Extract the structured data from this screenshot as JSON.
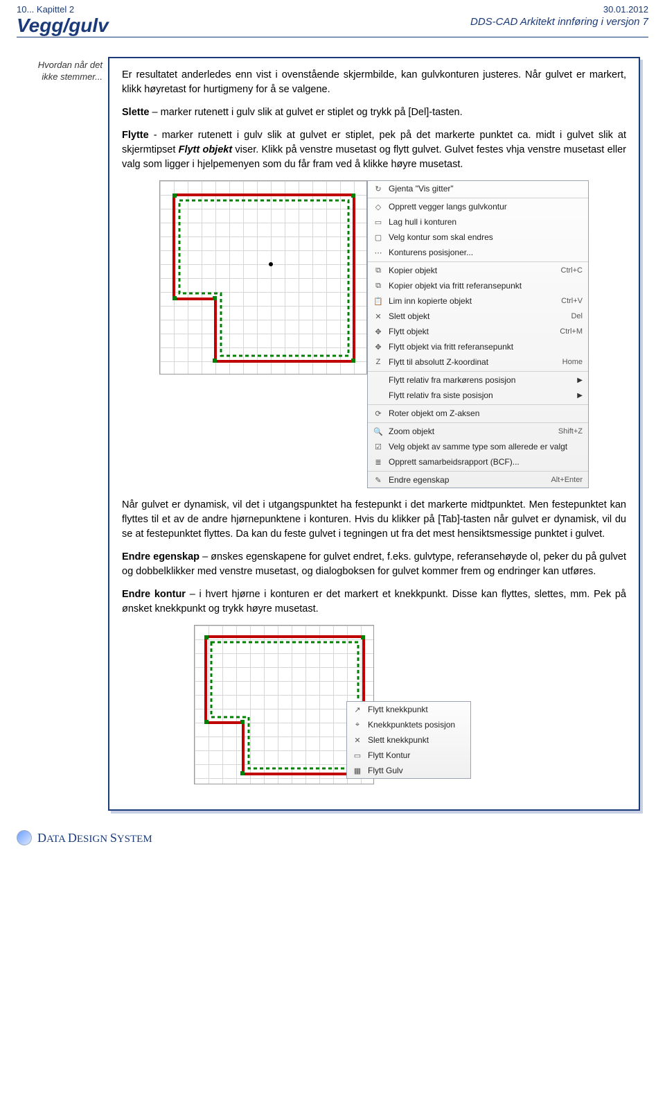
{
  "header": {
    "chapter_ref": "10... Kapittel 2",
    "section_title": "Vegg/gulv",
    "date": "30.01.2012",
    "product_name": "DDS-CAD Arkitekt innføring i versjon 7"
  },
  "margin_note": "Hvordan når det ikke stemmer...",
  "body": {
    "p1": "Er resultatet anderledes enn vist i ovenstående skjermbilde, kan gulvkonturen justeres. Når gulvet er markert, klikk høyretast for hurtigmeny for å se valgene.",
    "p2_prefix": "Slette",
    "p2_rest": " – marker rutenett i gulv slik at gulvet er stiplet og trykk på [Del]-tasten.",
    "p3_prefix": "Flytte",
    "p3_rest": " - marker rutenett i gulv slik at gulvet er stiplet, pek på det markerte punktet ca. midt i gulvet slik at skjermtipset ",
    "p3_em": "Flytt objekt",
    "p3_rest2": " viser. Klikk på venstre musetast og flytt gulvet. Gulvet festes vhja venstre musetast eller valg som ligger i hjelpemenyen som du får fram ved å klikke høyre musetast.",
    "p4": "Når gulvet er dynamisk, vil det i utgangspunktet ha festepunkt i det markerte midtpunktet. Men festepunktet kan flyttes til et av de andre hjørnepunktene i konturen. Hvis du klikker på [Tab]-tasten når gulvet er dynamisk, vil du se at festepunktet flyttes. Da kan du feste gulvet i tegningen ut fra det mest hensiktsmessige punktet i gulvet.",
    "p5_prefix": "Endre egenskap",
    "p5_rest": " – ønskes egenskapene for gulvet endret, f.eks. gulvtype, referansehøyde ol, peker du på gulvet og dobbelklikker med venstre musetast, og dialogboksen for gulvet kommer frem og endringer kan utføres.",
    "p6_prefix": "Endre kontur",
    "p6_rest": " – i hvert hjørne i konturen er det markert et knekkpunkt. Disse kan flyttes, slettes, mm. Pek på ønsket knekkpunkt og trykk høyre musetast."
  },
  "context_menu_main": [
    {
      "icon": "↻",
      "label": "Gjenta \"Vis gitter\"",
      "shortcut": ""
    },
    {
      "icon": "◇",
      "label": "Opprett vegger langs gulvkontur",
      "shortcut": "",
      "sep": true
    },
    {
      "icon": "▭",
      "label": "Lag hull i konturen",
      "shortcut": ""
    },
    {
      "icon": "▢",
      "label": "Velg kontur som skal endres",
      "shortcut": ""
    },
    {
      "icon": "⋯",
      "label": "Konturens posisjoner...",
      "shortcut": ""
    },
    {
      "icon": "⧉",
      "label": "Kopier objekt",
      "shortcut": "Ctrl+C",
      "sep": true
    },
    {
      "icon": "⧉",
      "label": "Kopier objekt via fritt referansepunkt",
      "shortcut": ""
    },
    {
      "icon": "📋",
      "label": "Lim inn kopierte objekt",
      "shortcut": "Ctrl+V"
    },
    {
      "icon": "✕",
      "label": "Slett objekt",
      "shortcut": "Del"
    },
    {
      "icon": "✥",
      "label": "Flytt objekt",
      "shortcut": "Ctrl+M"
    },
    {
      "icon": "✥",
      "label": "Flytt objekt via fritt referansepunkt",
      "shortcut": ""
    },
    {
      "icon": "Z",
      "label": "Flytt til absolutt Z-koordinat",
      "shortcut": "Home"
    },
    {
      "icon": "",
      "label": "Flytt relativ fra markørens posisjon",
      "shortcut": "",
      "submenu": true,
      "sep": true
    },
    {
      "icon": "",
      "label": "Flytt relativ fra siste posisjon",
      "shortcut": "",
      "submenu": true
    },
    {
      "icon": "⟳",
      "label": "Roter objekt om Z-aksen",
      "shortcut": "",
      "sep": true
    },
    {
      "icon": "🔍",
      "label": "Zoom objekt",
      "shortcut": "Shift+Z",
      "sep": true
    },
    {
      "icon": "☑",
      "label": "Velg objekt av samme type som allerede er valgt",
      "shortcut": ""
    },
    {
      "icon": "≣",
      "label": "Opprett samarbeidsrapport (BCF)...",
      "shortcut": ""
    },
    {
      "icon": "✎",
      "label": "Endre egenskap",
      "shortcut": "Alt+Enter",
      "sep": true
    }
  ],
  "context_menu_knekk": [
    {
      "icon": "↗",
      "label": "Flytt knekkpunkt"
    },
    {
      "icon": "⌖",
      "label": "Knekkpunktets posisjon"
    },
    {
      "icon": "✕",
      "label": "Slett knekkpunkt"
    },
    {
      "icon": "▭",
      "label": "Flytt Kontur"
    },
    {
      "icon": "▦",
      "label": "Flytt Gulv"
    }
  ],
  "footer": {
    "brand": "DATA DESIGN SYSTEM"
  }
}
